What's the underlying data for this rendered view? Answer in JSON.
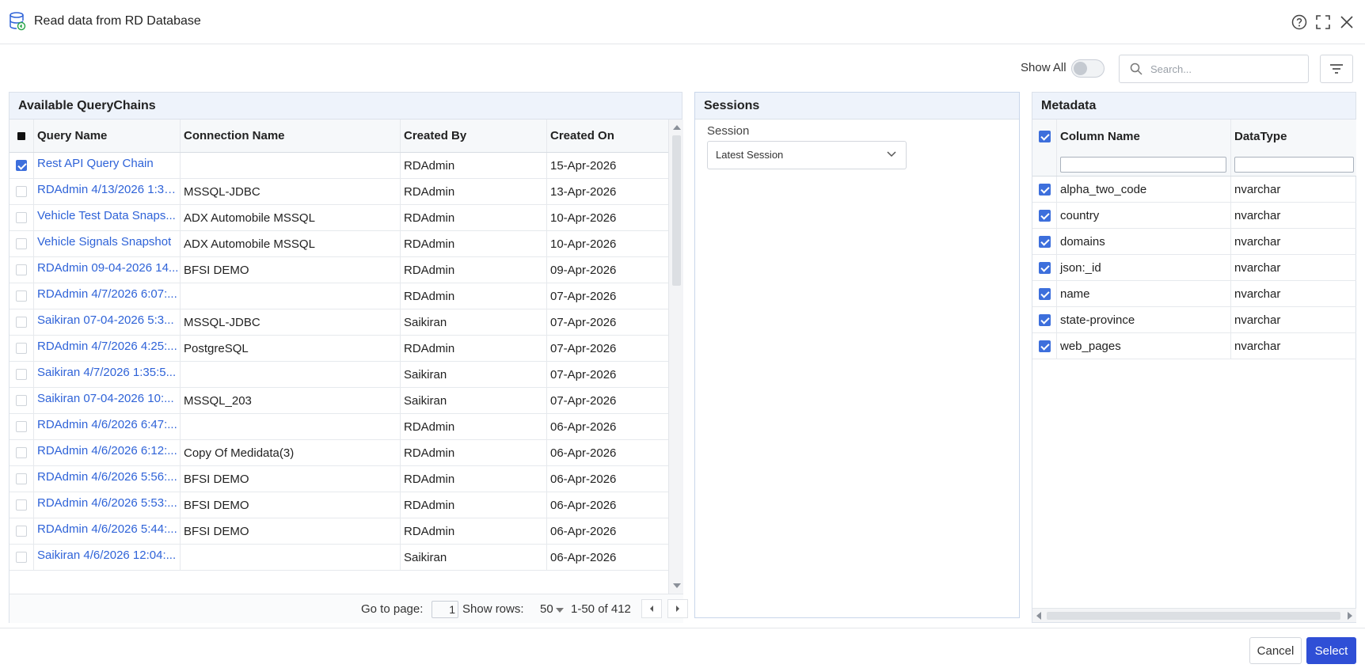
{
  "dialog": {
    "title": "Read data from RD Database"
  },
  "toolbar": {
    "show_all_label": "Show All",
    "show_all_on": false,
    "search_placeholder": "Search..."
  },
  "query_chains": {
    "title": "Available QueryChains",
    "columns": [
      "Query Name",
      "Connection Name",
      "Created By",
      "Created On"
    ],
    "rows": [
      {
        "checked": true,
        "query_name": "Rest API Query Chain",
        "connection": "",
        "created_by": "RDAdmin",
        "created_on": "15-Apr-2026"
      },
      {
        "checked": false,
        "query_name": "RDAdmin 4/13/2026 1:35:...",
        "connection": "MSSQL-JDBC",
        "created_by": "RDAdmin",
        "created_on": "13-Apr-2026"
      },
      {
        "checked": false,
        "query_name": "Vehicle Test Data Snaps...",
        "connection": "ADX Automobile MSSQL",
        "created_by": "RDAdmin",
        "created_on": "10-Apr-2026"
      },
      {
        "checked": false,
        "query_name": "Vehicle Signals Snapshot",
        "connection": "ADX Automobile MSSQL",
        "created_by": "RDAdmin",
        "created_on": "10-Apr-2026"
      },
      {
        "checked": false,
        "query_name": "RDAdmin 09-04-2026 14...",
        "connection": "BFSI DEMO",
        "created_by": "RDAdmin",
        "created_on": "09-Apr-2026"
      },
      {
        "checked": false,
        "query_name": "RDAdmin 4/7/2026 6:07:...",
        "connection": "",
        "created_by": "RDAdmin",
        "created_on": "07-Apr-2026"
      },
      {
        "checked": false,
        "query_name": "Saikiran 07-04-2026 5:3...",
        "connection": "MSSQL-JDBC",
        "created_by": "Saikiran",
        "created_on": "07-Apr-2026"
      },
      {
        "checked": false,
        "query_name": "RDAdmin 4/7/2026 4:25:...",
        "connection": "PostgreSQL",
        "created_by": "RDAdmin",
        "created_on": "07-Apr-2026"
      },
      {
        "checked": false,
        "query_name": "Saikiran 4/7/2026 1:35:5...",
        "connection": "",
        "created_by": "Saikiran",
        "created_on": "07-Apr-2026"
      },
      {
        "checked": false,
        "query_name": "Saikiran 07-04-2026 10:...",
        "connection": "MSSQL_203",
        "created_by": "Saikiran",
        "created_on": "07-Apr-2026"
      },
      {
        "checked": false,
        "query_name": "RDAdmin 4/6/2026 6:47:...",
        "connection": "",
        "created_by": "RDAdmin",
        "created_on": "06-Apr-2026"
      },
      {
        "checked": false,
        "query_name": "RDAdmin 4/6/2026 6:12:...",
        "connection": "Copy Of Medidata(3)",
        "created_by": "RDAdmin",
        "created_on": "06-Apr-2026"
      },
      {
        "checked": false,
        "query_name": "RDAdmin 4/6/2026 5:56:...",
        "connection": "BFSI DEMO",
        "created_by": "RDAdmin",
        "created_on": "06-Apr-2026"
      },
      {
        "checked": false,
        "query_name": "RDAdmin 4/6/2026 5:53:...",
        "connection": "BFSI DEMO",
        "created_by": "RDAdmin",
        "created_on": "06-Apr-2026"
      },
      {
        "checked": false,
        "query_name": "RDAdmin 4/6/2026 5:44:...",
        "connection": "BFSI DEMO",
        "created_by": "RDAdmin",
        "created_on": "06-Apr-2026"
      },
      {
        "checked": false,
        "query_name": "Saikiran 4/6/2026 12:04:...",
        "connection": "",
        "created_by": "Saikiran",
        "created_on": "06-Apr-2026"
      }
    ],
    "pager": {
      "goto_label": "Go to page:",
      "page": "1",
      "rows_label": "Show rows:",
      "rows_value": "50",
      "range": "1-50 of 412"
    }
  },
  "sessions": {
    "title": "Sessions",
    "label": "Session",
    "selected": "Latest Session"
  },
  "metadata": {
    "title": "Metadata",
    "columns": [
      "Column Name",
      "DataType"
    ],
    "all_checked": true,
    "rows": [
      {
        "checked": true,
        "name": "alpha_two_code",
        "type": "nvarchar"
      },
      {
        "checked": true,
        "name": "country",
        "type": "nvarchar"
      },
      {
        "checked": true,
        "name": "domains",
        "type": "nvarchar"
      },
      {
        "checked": true,
        "name": "json:_id",
        "type": "nvarchar"
      },
      {
        "checked": true,
        "name": "name",
        "type": "nvarchar"
      },
      {
        "checked": true,
        "name": "state-province",
        "type": "nvarchar"
      },
      {
        "checked": true,
        "name": "web_pages",
        "type": "nvarchar"
      }
    ]
  },
  "footer": {
    "cancel_label": "Cancel",
    "select_label": "Select"
  },
  "colors": {
    "accent": "#3d6fdc",
    "link": "#2f63d8",
    "primary_button": "#2f4fd6",
    "panel_header": "#eef3fb"
  }
}
